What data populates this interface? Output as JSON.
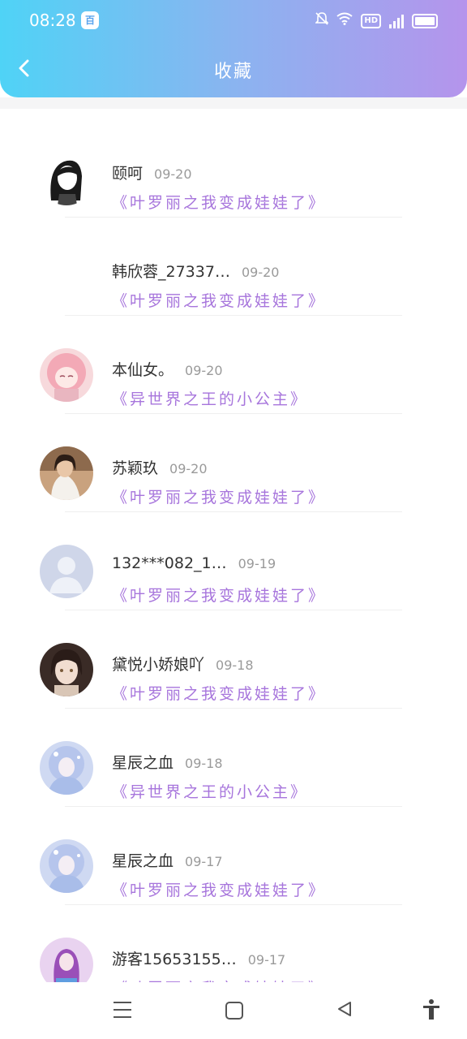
{
  "status": {
    "time": "08:28",
    "app_badge": "百",
    "hd": "HD",
    "net": "4G"
  },
  "header": {
    "title": "收藏"
  },
  "colors": {
    "accent_purple": "#a775dc",
    "header_start": "#4fd3f6",
    "header_end": "#b594ec"
  },
  "items": [
    {
      "name": "颐呵",
      "date": "09-20",
      "book": "《叶罗丽之我变成娃娃了》",
      "avatar": "girl-lineart"
    },
    {
      "name": "韩欣蓉_27337…",
      "date": "09-20",
      "book": "《叶罗丽之我变成娃娃了》",
      "avatar": "none"
    },
    {
      "name": "本仙女。",
      "date": "09-20",
      "book": "《异世界之王的小公主》",
      "avatar": "pink-anime"
    },
    {
      "name": "苏颖玖",
      "date": "09-20",
      "book": "《叶罗丽之我变成娃娃了》",
      "avatar": "photo-woman"
    },
    {
      "name": "132***082_1…",
      "date": "09-19",
      "book": "《叶罗丽之我变成娃娃了》",
      "avatar": "default-user"
    },
    {
      "name": "黛悦小娇娘吖",
      "date": "09-18",
      "book": "《叶罗丽之我变成娃娃了》",
      "avatar": "dark-anime"
    },
    {
      "name": "星辰之血",
      "date": "09-18",
      "book": "《异世界之王的小公主》",
      "avatar": "blue-anime"
    },
    {
      "name": "星辰之血",
      "date": "09-17",
      "book": "《叶罗丽之我变成娃娃了》",
      "avatar": "blue-anime"
    },
    {
      "name": "游客15653155…",
      "date": "09-17",
      "book": "《叶罗丽之我变成娃娃了》",
      "avatar": "purple-anime"
    }
  ]
}
